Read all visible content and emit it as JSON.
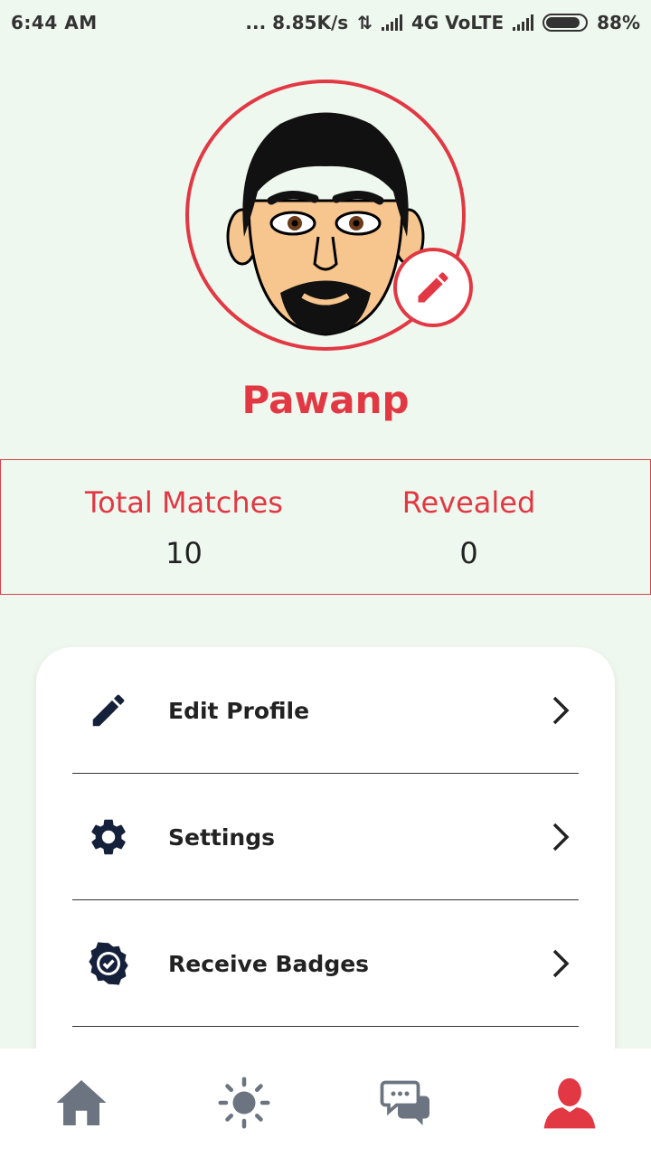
{
  "status_bar": {
    "time": "6:44 AM",
    "network_speed": "... 8.85K/s",
    "network_type": "4G VoLTE",
    "battery": "88%"
  },
  "profile": {
    "username": "Pawanp"
  },
  "stats": {
    "total_matches_label": "Total Matches",
    "total_matches_value": "10",
    "revealed_label": "Revealed",
    "revealed_value": "0"
  },
  "menu": {
    "items": [
      {
        "label": "Edit Profile",
        "icon": "pencil-icon"
      },
      {
        "label": "Settings",
        "icon": "gear-icon"
      },
      {
        "label": "Receive Badges",
        "icon": "badge-icon"
      }
    ]
  },
  "bottom_nav": {
    "items": [
      "home-icon",
      "sun-icon",
      "chat-icon",
      "user-icon"
    ],
    "active": "user-icon"
  },
  "colors": {
    "accent": "#e23844",
    "background": "#eff8ee",
    "icon_dark": "#15203a",
    "nav_inactive": "#6b7480"
  }
}
